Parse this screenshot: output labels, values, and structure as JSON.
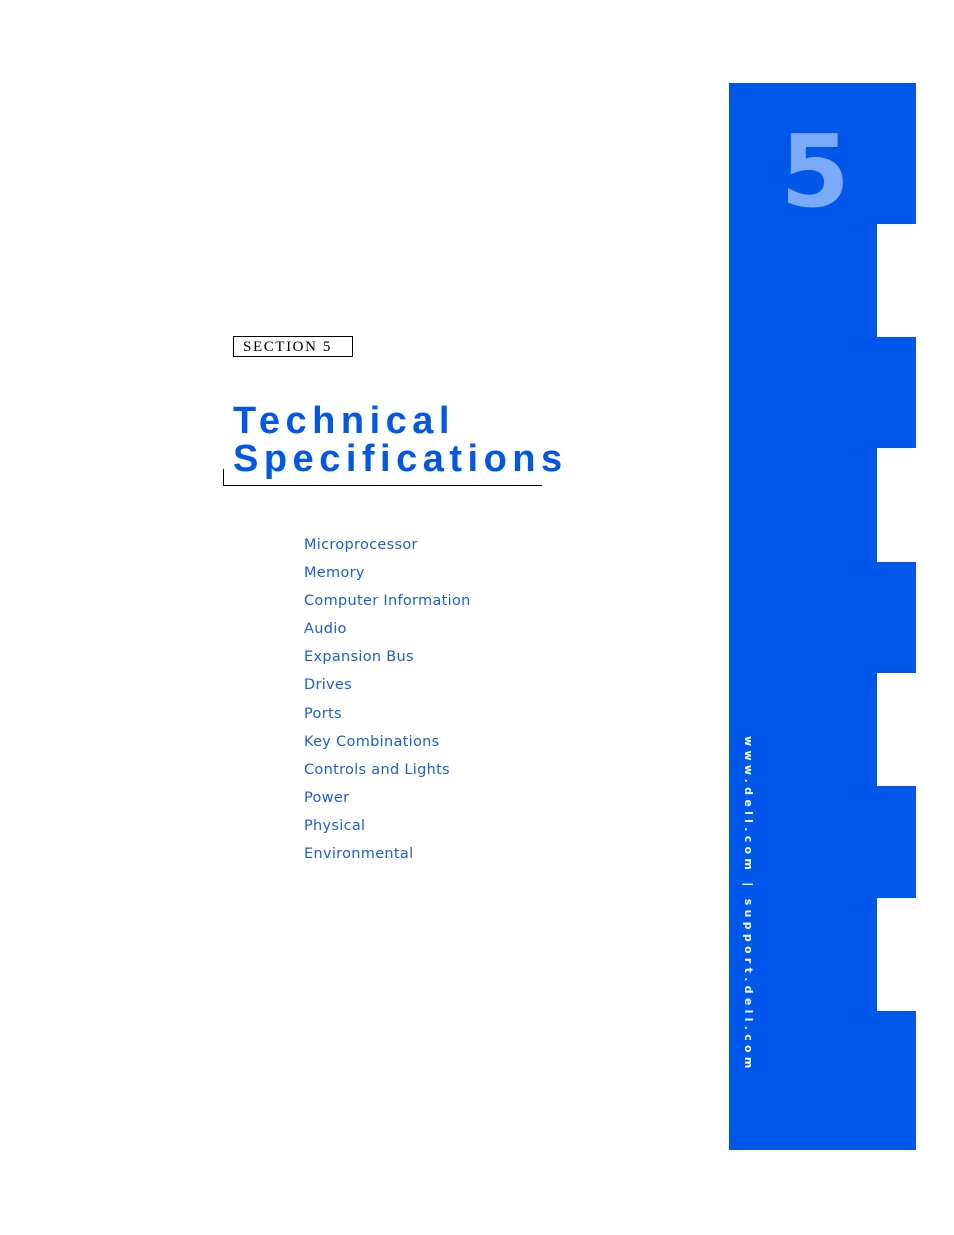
{
  "sidebar": {
    "chapter_number": "5",
    "vertical_text": "www.dell.com | support.dell.com",
    "accent_color": "#0057eb",
    "number_color": "#7aaaf8"
  },
  "section_label": "SECTION 5",
  "title_line1": "Technical",
  "title_line2": "Specifications",
  "toc": [
    {
      "label": "Microprocessor"
    },
    {
      "label": "Memory"
    },
    {
      "label": "Computer Information"
    },
    {
      "label": "Audio"
    },
    {
      "label": "Expansion Bus"
    },
    {
      "label": "Drives"
    },
    {
      "label": "Ports"
    },
    {
      "label": "Key Combinations"
    },
    {
      "label": "Controls and Lights"
    },
    {
      "label": "Power"
    },
    {
      "label": "Physical"
    },
    {
      "label": "Environmental"
    }
  ]
}
